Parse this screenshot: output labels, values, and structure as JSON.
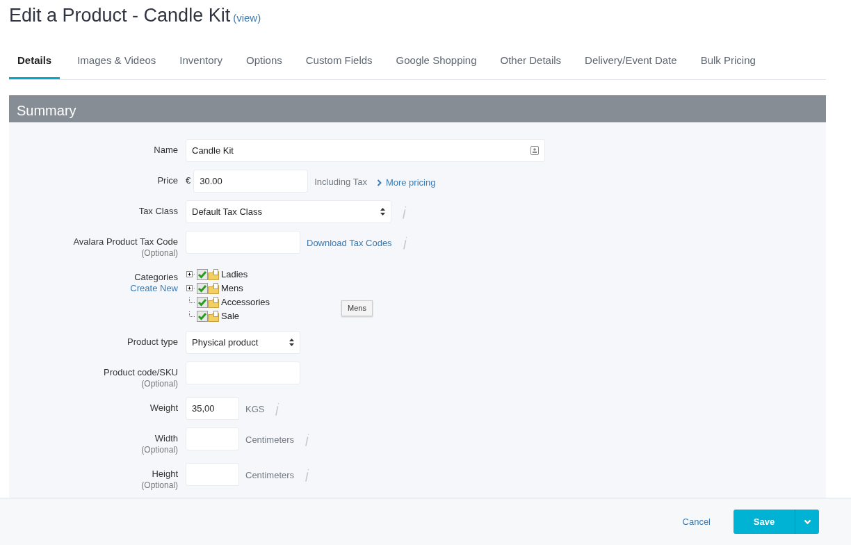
{
  "page_title": "Edit a Product - Candle Kit",
  "view_link": "(view)",
  "tabs": [
    {
      "label": "Details",
      "selected": true
    },
    {
      "label": "Images & Videos",
      "selected": false
    },
    {
      "label": "Inventory",
      "selected": false
    },
    {
      "label": "Options",
      "selected": false
    },
    {
      "label": "Custom Fields",
      "selected": false
    },
    {
      "label": "Google Shopping",
      "selected": false
    },
    {
      "label": "Other Details",
      "selected": false
    },
    {
      "label": "Delivery/Event Date",
      "selected": false
    },
    {
      "label": "Bulk Pricing",
      "selected": false
    }
  ],
  "section_title": "Summary",
  "fields": [
    {
      "kind": "name",
      "label": "Name",
      "value": "Candle Kit"
    },
    {
      "kind": "price",
      "label": "Price",
      "currency": "€",
      "value": "30.00",
      "suffix": "Including Tax",
      "link": "More pricing"
    },
    {
      "kind": "select",
      "label": "Tax Class",
      "value": "Default Tax Class",
      "info": true
    },
    {
      "kind": "text",
      "label": "Avalara Product Tax Code",
      "optional": "(Optional)",
      "link": "Download Tax Codes",
      "info": true
    },
    {
      "kind": "tree",
      "label": "Categories",
      "link": "Create New",
      "items": [
        {
          "label": "Ladies",
          "expandable": true,
          "checked": true
        },
        {
          "label": "Mens",
          "expandable": true,
          "checked": true
        },
        {
          "label": "Accessories",
          "expandable": false,
          "checked": true
        },
        {
          "label": "Sale",
          "expandable": false,
          "checked": true
        }
      ],
      "tooltip": "Mens"
    },
    {
      "kind": "select",
      "label": "Product type",
      "value": "Physical product"
    },
    {
      "kind": "text",
      "label": "Product code/SKU",
      "optional": "(Optional)"
    },
    {
      "kind": "text",
      "label": "Weight",
      "value": "35,00",
      "suffix": "KGS",
      "info": true
    },
    {
      "kind": "text",
      "label": "Width",
      "optional": "(Optional)",
      "suffix": "Centimeters",
      "info": true
    },
    {
      "kind": "text",
      "label": "Height",
      "optional": "(Optional)",
      "suffix": "Centimeters",
      "info": true
    }
  ],
  "footer": {
    "cancel": "Cancel",
    "save": "Save"
  }
}
